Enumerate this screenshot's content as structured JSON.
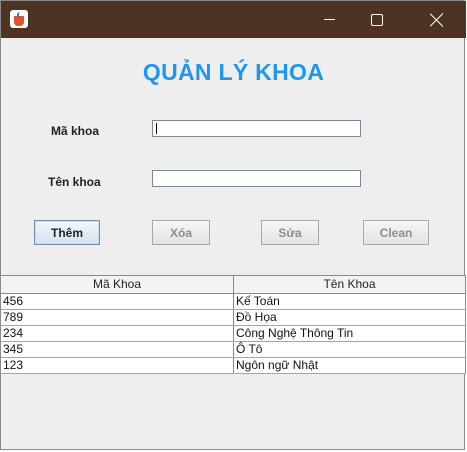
{
  "window": {
    "title": "",
    "icon": "java-cup-icon"
  },
  "header": {
    "title": "QUẢN LÝ KHOA"
  },
  "form": {
    "ma_khoa_label": "Mã khoa",
    "ma_khoa_value": "",
    "ten_khoa_label": "Tên khoa",
    "ten_khoa_value": ""
  },
  "buttons": {
    "them": "Thêm",
    "xoa": "Xóa",
    "sua": "Sửa",
    "clean": "Clean"
  },
  "table": {
    "columns": [
      "Mã Khoa",
      "Tên Khoa"
    ],
    "rows": [
      [
        "456",
        "Kế Toán"
      ],
      [
        "789",
        "Đồ Họa"
      ],
      [
        "234",
        "Công Nghệ Thông Tin"
      ],
      [
        "345",
        "Ô Tô"
      ],
      [
        "123",
        "Ngôn ngữ Nhật"
      ]
    ]
  }
}
